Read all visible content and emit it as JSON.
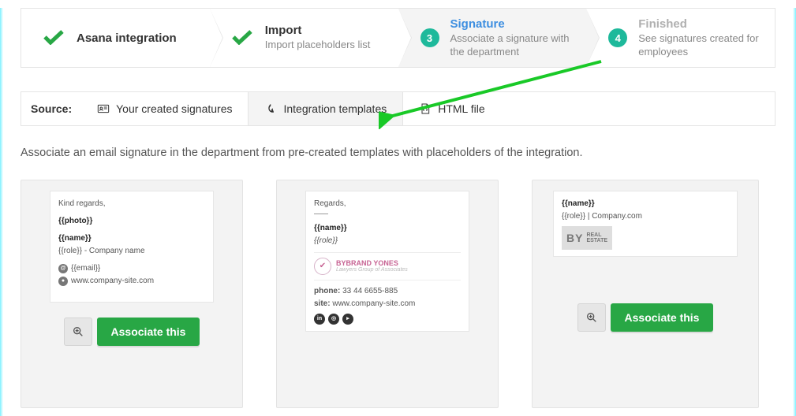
{
  "steps": [
    {
      "title": "Asana integration",
      "sub": ""
    },
    {
      "title": "Import",
      "sub": "Import placeholders list"
    },
    {
      "badge": "3",
      "title": "Signature",
      "sub": "Associate a signature with the department"
    },
    {
      "badge": "4",
      "title": "Finished",
      "sub": "See signatures created for employees"
    }
  ],
  "source": {
    "label": "Source:",
    "tabs": [
      "Your created signatures",
      "Integration templates",
      "HTML file"
    ]
  },
  "helper": "Associate an email signature in the department from pre-created templates with placeholders of the integration.",
  "actions": {
    "associate": "Associate this"
  },
  "cards": [
    {
      "greeting": "Kind regards,",
      "photo": "{{photo}}",
      "name": "{{name}}",
      "role": "{{role}} - Company name",
      "email": "{{email}}",
      "site": "www.company-site.com"
    },
    {
      "greeting": "Regards,",
      "name": "{{name}}",
      "role": "{{role}}",
      "brand": "BYBRAND YONES",
      "brandsub": "Lawyers Group of Associates",
      "phone_label": "phone:",
      "phone": "33 44 6655-885",
      "site_label": "site:",
      "site": "www.company-site.com"
    },
    {
      "name": "{{name}}",
      "role": "{{role}} | Company.com",
      "logo_big": "BY",
      "logo_l1": "REAL",
      "logo_l2": "ESTATE"
    }
  ]
}
